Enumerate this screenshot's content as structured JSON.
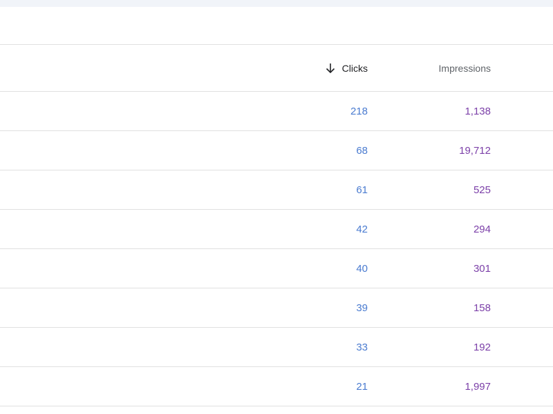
{
  "table": {
    "columns": {
      "clicks": {
        "label": "Clicks",
        "sort_icon": "arrow-down-icon"
      },
      "impressions": {
        "label": "Impressions"
      }
    },
    "rows": [
      {
        "clicks": "218",
        "impressions": "1,138"
      },
      {
        "clicks": "68",
        "impressions": "19,712"
      },
      {
        "clicks": "61",
        "impressions": "525"
      },
      {
        "clicks": "42",
        "impressions": "294"
      },
      {
        "clicks": "40",
        "impressions": "301"
      },
      {
        "clicks": "39",
        "impressions": "158"
      },
      {
        "clicks": "33",
        "impressions": "192"
      },
      {
        "clicks": "21",
        "impressions": "1,997"
      }
    ],
    "colors": {
      "clicks": "#4a7bd0",
      "impressions": "#7b3fa8"
    }
  }
}
